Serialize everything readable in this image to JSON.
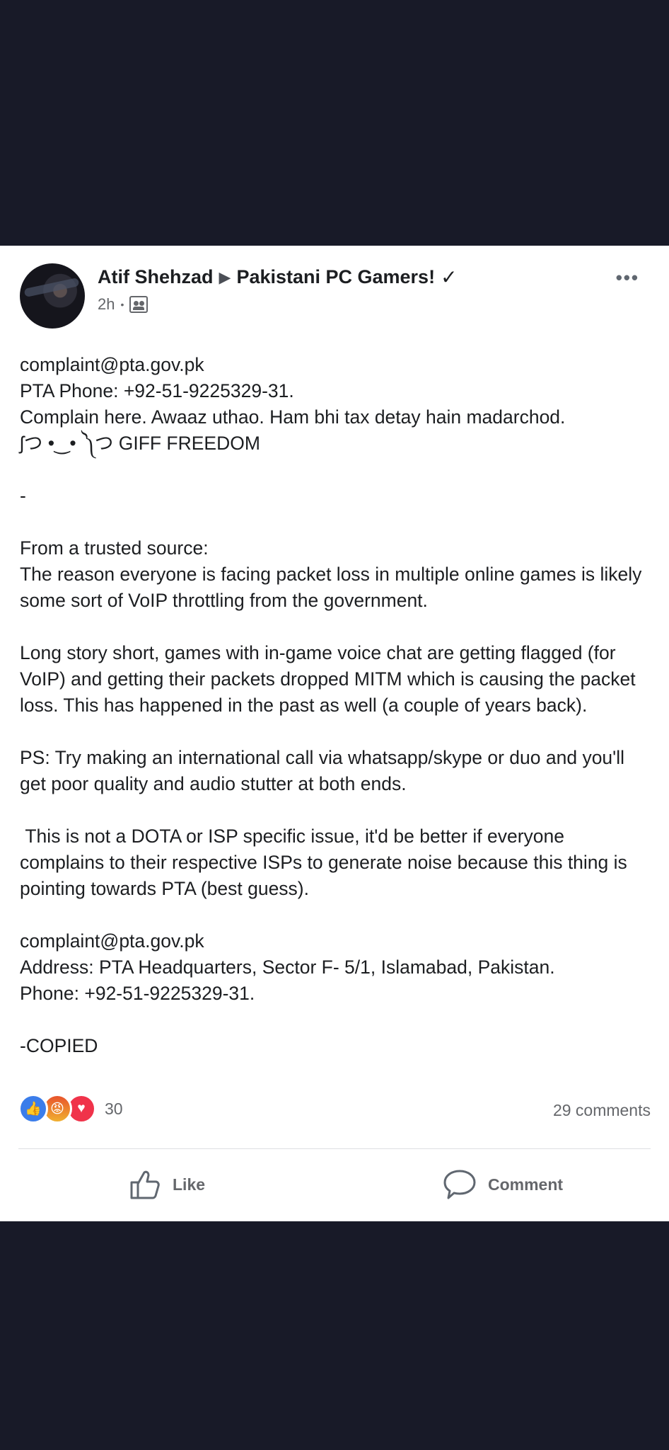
{
  "post": {
    "author": "Atif Shehzad",
    "group": "Pakistani PC Gamers!",
    "time": "2h",
    "body": [
      "complaint@pta.gov.pk",
      "PTA Phone: +92-51-9225329-31.",
      "Complain here. Awaaz uthao. Ham bhi tax detay hain madarchod.",
      "ʃつ •‿• ༽つ GIFF FREEDOM",
      "",
      "-",
      "",
      "From a trusted source:",
      "The reason everyone is facing packet loss in multiple online games is likely some sort of VoIP throttling from the government.",
      "",
      "Long story short, games with in-game voice chat are getting flagged (for VoIP) and getting their packets dropped MITM which is causing the packet loss. This has happened in the past as well (a couple of years back).",
      "",
      "PS: Try making an international call via whatsapp/skype or duo and you'll get poor quality and audio stutter at both ends.",
      "",
      " This is not a DOTA or ISP specific issue, it'd be better if everyone complains to their respective ISPs to generate noise because this thing is pointing towards PTA (best guess).",
      "",
      "complaint@pta.gov.pk",
      "Address: PTA Headquarters, Sector F- 5/1, Islamabad, Pakistan.",
      "Phone: +92-51-9225329-31.",
      "",
      "-COPIED"
    ]
  },
  "reactions": {
    "count": "30",
    "types": [
      "like",
      "angry",
      "love"
    ]
  },
  "comments_count": "29 comments",
  "actions": {
    "like_label": "Like",
    "comment_label": "Comment"
  },
  "icons": {
    "separator": "▶",
    "verified": "✓",
    "more": "•••"
  }
}
